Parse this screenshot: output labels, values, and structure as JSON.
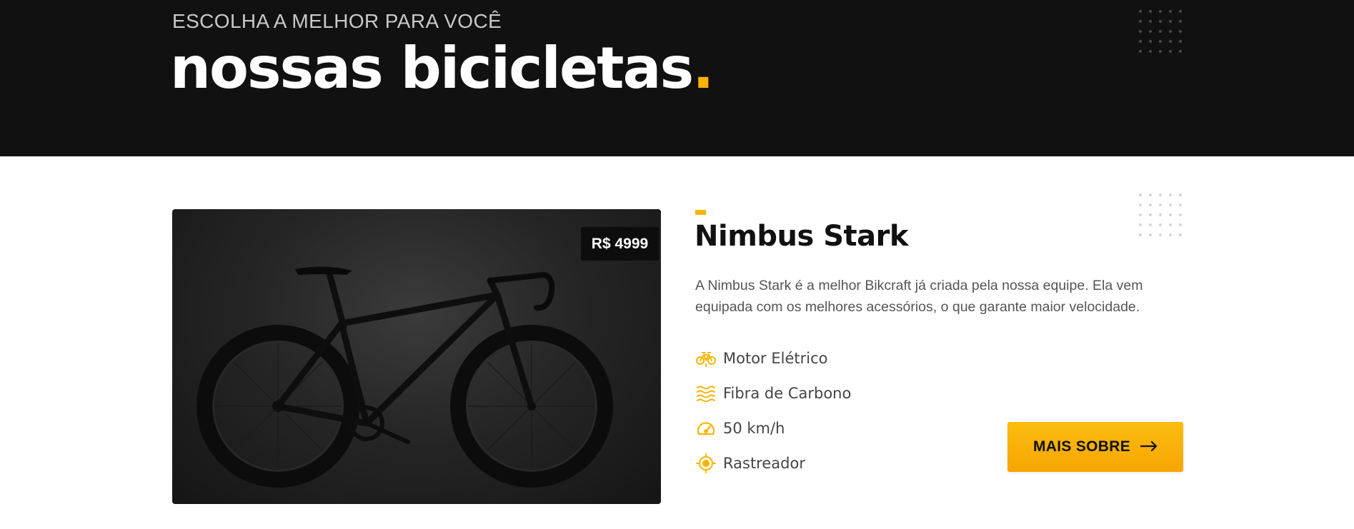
{
  "hero": {
    "eyebrow": "ESCOLHA A MELHOR PARA VOCÊ",
    "title": "nossas bicicletas",
    "title_dot": "."
  },
  "product": {
    "price": "R$ 4999",
    "name": "Nimbus Stark",
    "description": "A Nimbus Stark é a melhor Bikcraft já criada pela nossa equipe. Ela vem equipada com os melhores acessórios, o que garante maior velocidade.",
    "features": [
      {
        "label": "Motor Elétrico",
        "icon": "electric-bike-icon"
      },
      {
        "label": "Fibra de Carbono",
        "icon": "carbon-fiber-icon"
      },
      {
        "label": "50 km/h",
        "icon": "speedometer-icon"
      },
      {
        "label": "Rastreador",
        "icon": "tracker-icon"
      }
    ],
    "cta_label": "MAIS SOBRE",
    "cta_icon": "arrow-right-icon"
  },
  "colors": {
    "accent": "#fbb300",
    "dark": "#111111",
    "text": "#444444"
  }
}
